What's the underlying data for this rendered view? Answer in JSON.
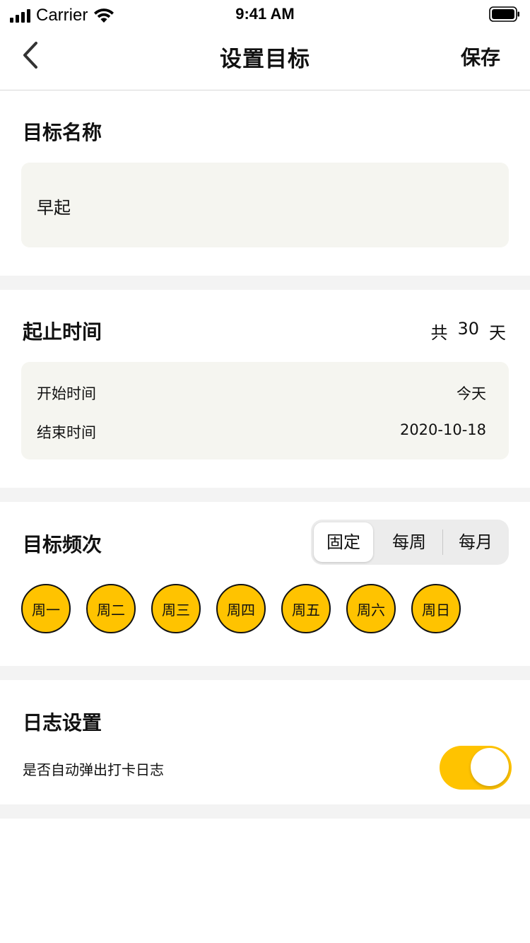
{
  "status_bar": {
    "carrier": "Carrier",
    "time": "9:41 AM"
  },
  "nav": {
    "title": "设置目标",
    "save_label": "保存"
  },
  "goal_name": {
    "title": "目标名称",
    "value": "早起"
  },
  "duration": {
    "title": "起止时间",
    "total_prefix": "共",
    "total_days": "30",
    "total_suffix": "天",
    "start_label": "开始时间",
    "start_value": "今天",
    "end_label": "结束时间",
    "end_value": "2020-10-18"
  },
  "frequency": {
    "title": "目标频次",
    "segments": [
      "固定",
      "每周",
      "每月"
    ],
    "selected_segment": "固定",
    "days": [
      "周一",
      "周二",
      "周三",
      "周四",
      "周五",
      "周六",
      "周日"
    ]
  },
  "log_settings": {
    "title": "日志设置",
    "auto_popup_label": "是否自动弹出打卡日志",
    "auto_popup_enabled": true
  },
  "colors": {
    "accent": "#ffc300",
    "box_bg": "#f5f5f0",
    "divider": "#f3f3f3"
  }
}
